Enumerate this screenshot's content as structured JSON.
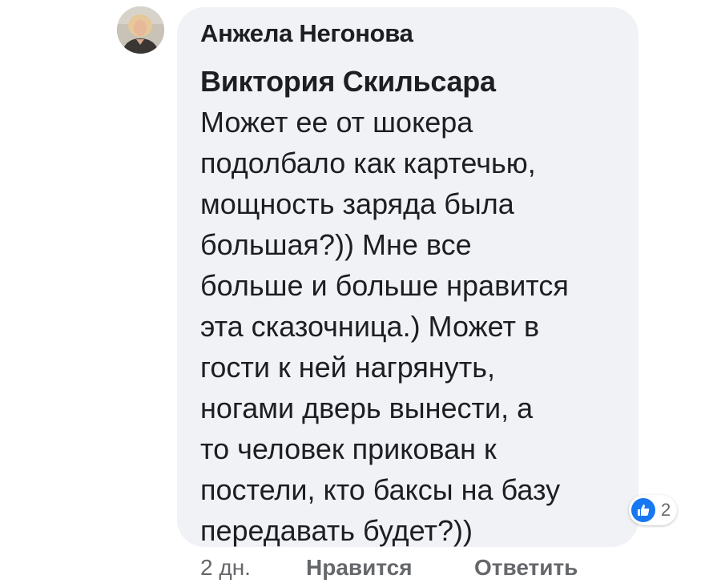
{
  "comment": {
    "author": "Анжела Негонова",
    "mention": "Виктория Скильсара",
    "text_lines": [
      "Может ее от шокера",
      "подолбало как картечью,",
      "мощность заряда была",
      "большая?)) Мне все",
      "больше и больше нравится",
      "эта сказочница.) Может в",
      "гости к ней нагрянуть,",
      "ногами дверь вынести, а",
      "то человек прикован к",
      "постели, кто баксы на базу",
      "передавать будет?))"
    ],
    "reaction": {
      "icon": "like-icon",
      "count": "2",
      "color": "#1877f2"
    }
  },
  "actions": {
    "time": "2 дн.",
    "like_label": "Нравится",
    "reply_label": "Ответить"
  },
  "colors": {
    "bubble": "#f0f2f5",
    "text": "#1c1e21",
    "secondary": "#65676b"
  }
}
